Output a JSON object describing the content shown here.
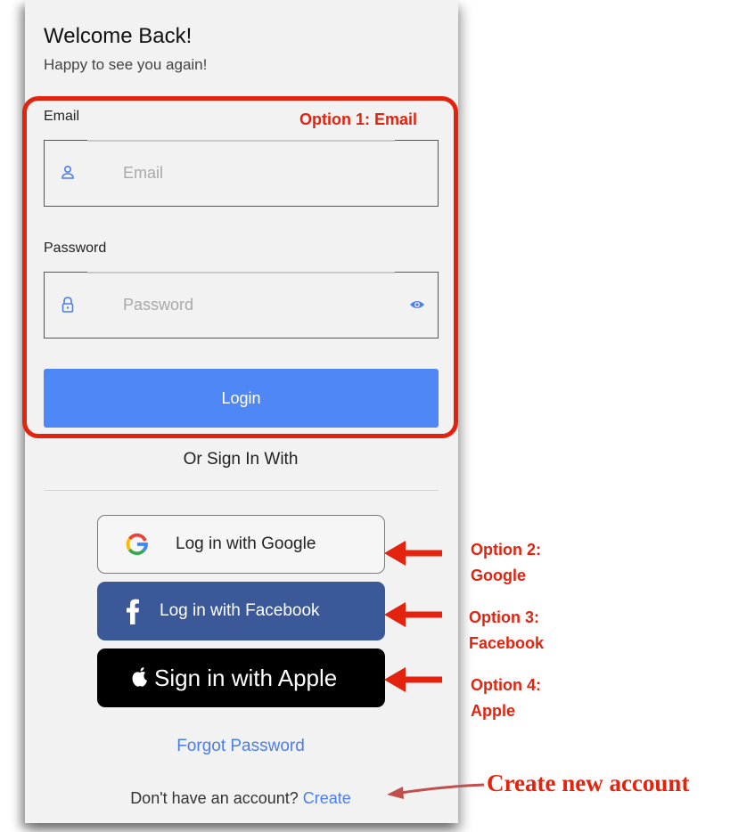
{
  "header": {
    "title": "Welcome Back!",
    "subtitle": "Happy to see you again!"
  },
  "email_section": {
    "annotation": "Option 1: Email",
    "email_label": "Email",
    "email_placeholder": "Email",
    "password_label": "Password",
    "password_placeholder": "Password",
    "login_label": "Login"
  },
  "alt_signin": {
    "or_text": "Or Sign In With",
    "google_label": "Log in with Google",
    "facebook_label": "Log in with Facebook",
    "apple_label": "Sign in with Apple"
  },
  "footer": {
    "forgot_label": "Forgot Password",
    "signup_text": "Don't have an account?",
    "create_label": "Create"
  },
  "annotations": {
    "google_line1": "Option 2:",
    "google_line2": "Google",
    "facebook_line1": "Option 3:",
    "facebook_line2": "Facebook",
    "apple_line1": "Option 4:",
    "apple_line2": "Apple",
    "create_account": "Create new account"
  },
  "colors": {
    "annotation_red": "#e4230f",
    "primary_blue": "#4f87f6",
    "facebook_blue": "#3b5998",
    "apple_black": "#000000",
    "link_blue": "#4a7df0"
  },
  "icons": {
    "email_field": "person-icon",
    "password_field": "lock-icon",
    "password_toggle": "eye-icon",
    "google": "google-icon",
    "facebook": "facebook-icon",
    "apple": "apple-icon"
  }
}
